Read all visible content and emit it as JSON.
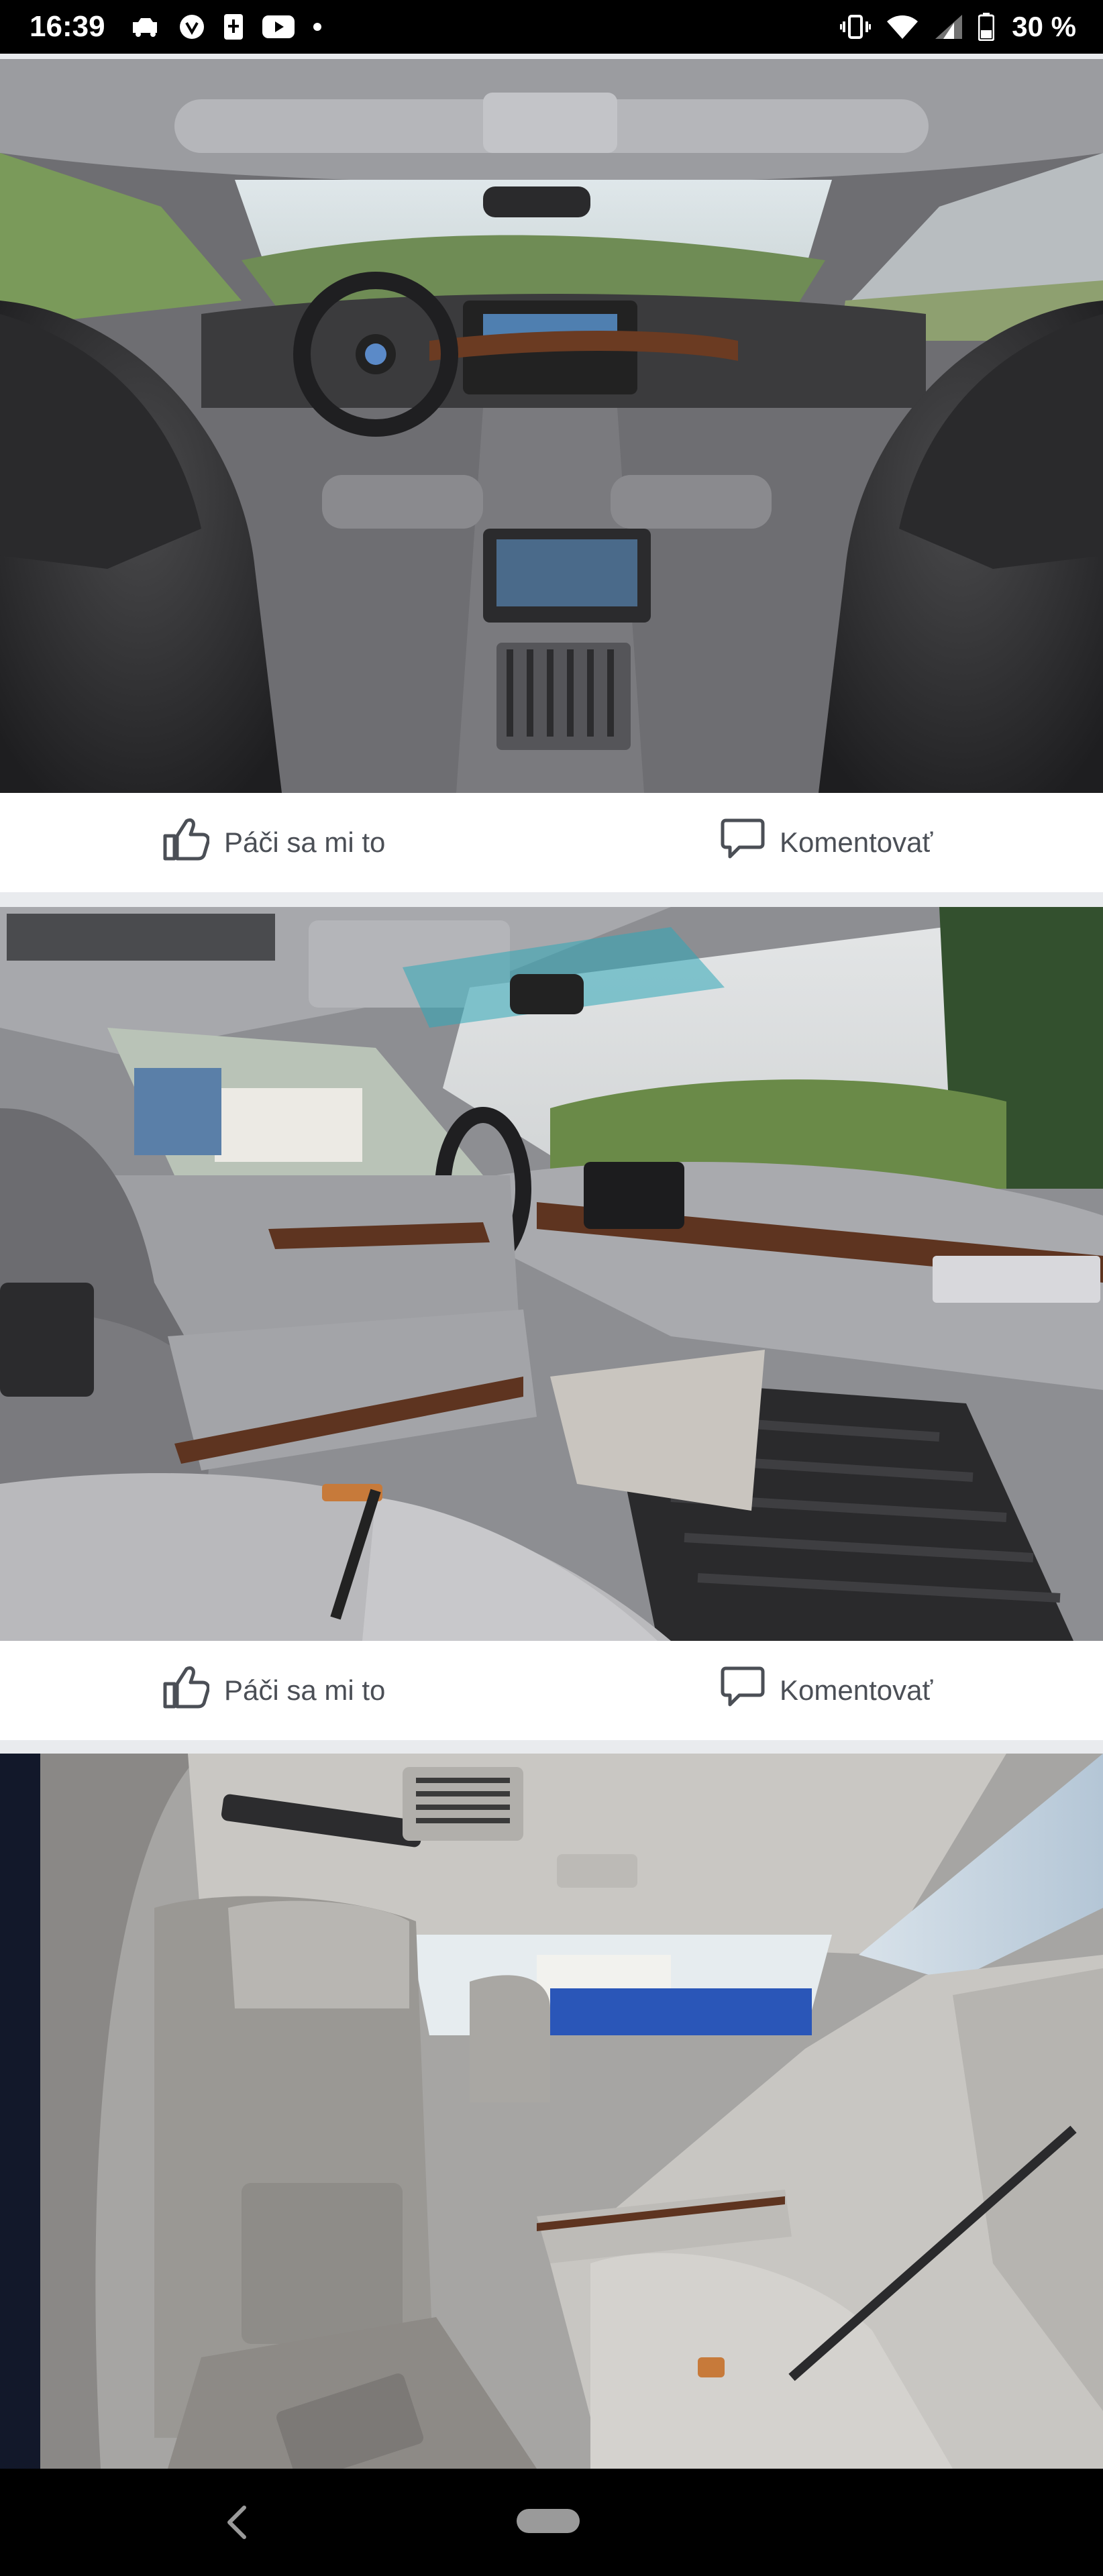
{
  "status_bar": {
    "time": "16:39",
    "left_icons": [
      "car-icon",
      "app-icon",
      "sim-icon",
      "youtube-icon",
      "dot-icon"
    ],
    "right_icons": [
      "vibrate-icon",
      "wifi-icon",
      "signal-icon",
      "battery-icon"
    ],
    "battery_percent": "30 %"
  },
  "feed": {
    "posts": [
      {
        "photo_icon": "photo-icon",
        "like_label": "Páči sa mi to",
        "comment_label": "Komentovať"
      },
      {
        "photo_icon": "photo-icon",
        "like_label": "Páči sa mi to",
        "comment_label": "Komentovať"
      },
      {
        "photo_icon": "photo-icon"
      }
    ]
  },
  "nav_bar": {
    "back_icon": "back-icon",
    "home_icon": "home-pill-icon"
  },
  "colors": {
    "background": "#e9ebee",
    "action_text": "#4b4f56",
    "status_bar": "#000000"
  }
}
